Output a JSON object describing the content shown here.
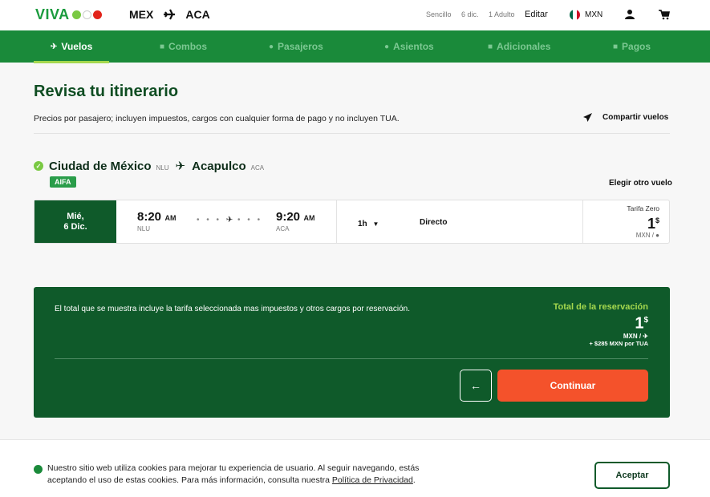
{
  "header": {
    "logo": "VIVA",
    "origin": "MEX",
    "destination": "ACA",
    "trip_type": "Sencillo",
    "date": "6 dic.",
    "passengers": "1 Adulto",
    "edit": "Editar",
    "currency": "MXN"
  },
  "nav": {
    "items": [
      {
        "label": "Vuelos",
        "icon": "plane-icon",
        "active": true
      },
      {
        "label": "Combos",
        "icon": "combo-icon",
        "active": false
      },
      {
        "label": "Pasajeros",
        "icon": "person-icon",
        "active": false
      },
      {
        "label": "Asientos",
        "icon": "seat-icon",
        "active": false
      },
      {
        "label": "Adicionales",
        "icon": "extras-icon",
        "active": false
      },
      {
        "label": "Pagos",
        "icon": "card-icon",
        "active": false
      }
    ]
  },
  "main": {
    "title": "Revisa tu itinerario",
    "subtitle": "Precios por pasajero; incluyen impuestos, cargos con cualquier forma de pago y no incluyen TUA.",
    "share": "Compartir vuelos"
  },
  "flight": {
    "origin_city": "Ciudad de México",
    "origin_code": "NLU",
    "dest_city": "Acapulco",
    "dest_code": "ACA",
    "badge": "AIFA",
    "change": "Elegir otro vuelo",
    "day": "Mié,",
    "date": "6 Dic.",
    "depart_time": "8:20",
    "depart_ampm": "AM",
    "depart_code": "NLU",
    "arrive_time": "9:20",
    "arrive_ampm": "AM",
    "arrive_code": "ACA",
    "duration": "1h",
    "stops": "Directo",
    "fare_name": "Tarifa Zero",
    "fare_price": "1",
    "fare_symbol": "$",
    "fare_unit": "MXN /"
  },
  "total": {
    "note": "El total que se muestra incluye la tarifa seleccionada mas impuestos y otros cargos por reservación.",
    "label": "Total de la reservación",
    "price": "1",
    "symbol": "$",
    "unit": "MXN /",
    "tua": "+ $285 MXN por TUA",
    "continue": "Continuar"
  },
  "cookies": {
    "text": "Nuestro sitio web utiliza cookies para mejorar tu experiencia de usuario. Al seguir navegando, estás aceptando el uso de estas cookies. Para más información, consulta nuestra ",
    "link": "Política de Privacidad",
    "end": ".",
    "accept": "Aceptar"
  },
  "colors": {
    "brand_green": "#1a8a3a",
    "dark_green": "#0f5a2a",
    "accent_lime": "#a5d84e",
    "cta_orange": "#f4522b"
  }
}
